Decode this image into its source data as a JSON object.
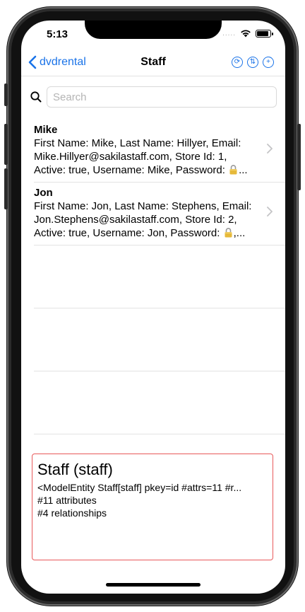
{
  "status": {
    "time": "5:13",
    "signal_dots": "....."
  },
  "nav": {
    "back_label": "dvdrental",
    "title": "Staff",
    "actions": [
      "refresh-icon",
      "sort-icon",
      "add-icon"
    ]
  },
  "search": {
    "placeholder": "Search"
  },
  "staff": [
    {
      "name": "Mike",
      "line1": "First Name: Mike, Last Name: Hillyer, Email:",
      "line2": "Mike.Hillyer@sakilastaff.com, Store Id: 1,",
      "line3": "Active: true, Username: Mike, Password: ",
      "line3_tail": "..."
    },
    {
      "name": "Jon",
      "line1": "First Name: Jon, Last Name: Stephens, Email:",
      "line2": "Jon.Stephens@sakilastaff.com, Store Id: 2,",
      "line3": "Active: true, Username: Jon, Password: ",
      "line3_tail": ",..."
    }
  ],
  "info": {
    "heading": "Staff (staff)",
    "entity": "<ModelEntity Staff[staff] pkey=id #attrs=11 #r...",
    "attributes": "#11 attributes",
    "relationships": "#4 relationships"
  },
  "colors": {
    "accent": "#1a73e8",
    "info_border": "#e8595a"
  }
}
